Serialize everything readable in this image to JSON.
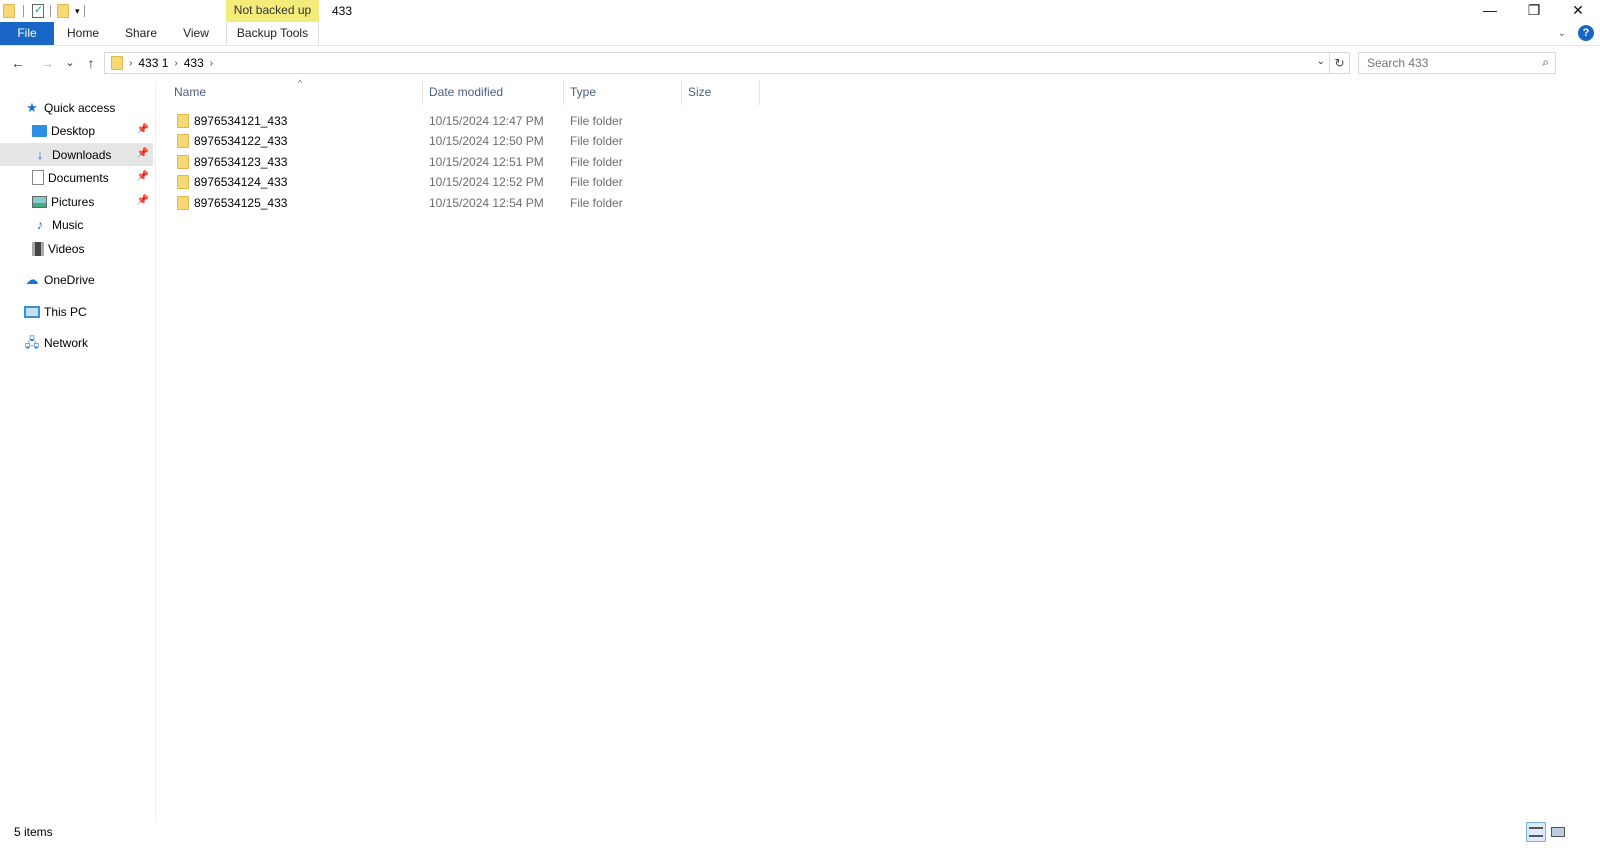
{
  "titlebar": {
    "context_tab_label": "Not backed up",
    "window_title": "433",
    "minimize": "—",
    "restore": "❐",
    "close": "✕"
  },
  "ribbon": {
    "tabs": [
      {
        "label": "File"
      },
      {
        "label": "Home"
      },
      {
        "label": "Share"
      },
      {
        "label": "View"
      },
      {
        "label": "Backup Tools"
      }
    ],
    "help": "?"
  },
  "navigation": {
    "back": "←",
    "forward": "→",
    "recent": "⌄",
    "up": "↑",
    "breadcrumbs": [
      "433 1",
      "433"
    ],
    "refresh": "↻",
    "search_placeholder": "Search 433",
    "search_icon": "search-icon"
  },
  "navpane": {
    "items": [
      {
        "label": "Quick access",
        "icon": "star-icon"
      },
      {
        "label": "Desktop",
        "icon": "desktop-icon",
        "pinned": true
      },
      {
        "label": "Downloads",
        "icon": "download-icon",
        "pinned": true,
        "selected": true
      },
      {
        "label": "Documents",
        "icon": "documents-icon",
        "pinned": true
      },
      {
        "label": "Pictures",
        "icon": "pictures-icon",
        "pinned": true
      },
      {
        "label": "Music",
        "icon": "music-icon"
      },
      {
        "label": "Videos",
        "icon": "videos-icon"
      },
      {
        "label": "OneDrive",
        "icon": "cloud-icon"
      },
      {
        "label": "This PC",
        "icon": "computer-icon"
      },
      {
        "label": "Network",
        "icon": "network-icon"
      }
    ]
  },
  "filelist": {
    "columns": [
      "Name",
      "Date modified",
      "Type",
      "Size"
    ],
    "rows": [
      {
        "name": "8976534121_433",
        "date": "10/15/2024 12:47 PM",
        "type": "File folder",
        "size": ""
      },
      {
        "name": "8976534122_433",
        "date": "10/15/2024 12:50 PM",
        "type": "File folder",
        "size": ""
      },
      {
        "name": "8976534123_433",
        "date": "10/15/2024 12:51 PM",
        "type": "File folder",
        "size": ""
      },
      {
        "name": "8976534124_433",
        "date": "10/15/2024 12:52 PM",
        "type": "File folder",
        "size": ""
      },
      {
        "name": "8976534125_433",
        "date": "10/15/2024 12:54 PM",
        "type": "File folder",
        "size": ""
      }
    ]
  },
  "statusbar": {
    "item_count": "5 items"
  },
  "colors": {
    "file_tab": "#1a66c6",
    "context_tab": "#f3ec7a",
    "selection": "#e5e5e5",
    "folder": "#f8d775"
  }
}
